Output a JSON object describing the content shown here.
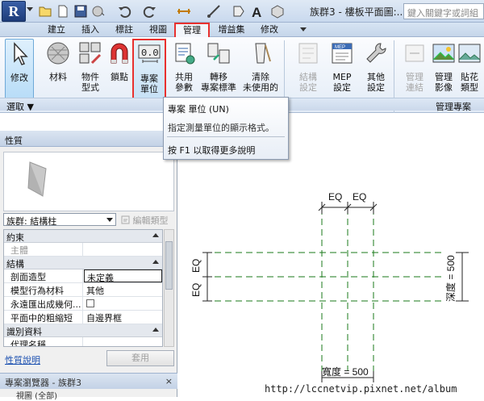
{
  "app": {
    "logo": "R",
    "title": "族群3 - 樓板平面圖:..",
    "search_placeholder": "鍵入關鍵字或詞組"
  },
  "tabs": [
    "建立",
    "插入",
    "標註",
    "視圖",
    "管理",
    "增益集",
    "修改"
  ],
  "active_tab": "管理",
  "ribbon": {
    "buttons": [
      {
        "id": "modify",
        "label": "修改",
        "icon": "cursor-icon"
      },
      {
        "id": "materials",
        "label": "材料",
        "icon": "sphere-icon"
      },
      {
        "id": "object-styles",
        "label": "物件\n型式",
        "icon": "object-styles-icon"
      },
      {
        "id": "snaps",
        "label": "鎖點",
        "icon": "magnet-icon"
      },
      {
        "id": "project-units",
        "label": "專案\n單位",
        "icon": "units-icon"
      },
      {
        "id": "shared-params",
        "label": "共用\n參數",
        "icon": "shared-params-icon"
      },
      {
        "id": "transfer-standards",
        "label": "轉移\n專案標準",
        "icon": "transfer-icon"
      },
      {
        "id": "purge-unused",
        "label": "清除\n未使用的",
        "icon": "purge-icon"
      },
      {
        "id": "structural-settings",
        "label": "結構\n設定",
        "icon": "structural-icon",
        "disabled": true
      },
      {
        "id": "mep-settings",
        "label": "MEP\n設定",
        "icon": "mep-icon"
      },
      {
        "id": "other-settings",
        "label": "其他\n設定",
        "icon": "wrench-icon"
      },
      {
        "id": "manage-links",
        "label": "管理\n連結",
        "icon": "links-icon",
        "disabled": true
      },
      {
        "id": "manage-images",
        "label": "管理\n影像",
        "icon": "images-icon"
      },
      {
        "id": "decal-types",
        "label": "貼花\n類型",
        "icon": "decal-icon"
      }
    ],
    "panel_select": "選取 ▼",
    "panel_manage_project": "管理專案"
  },
  "tooltip": {
    "title": "專案 單位 (UN)",
    "description": "指定測量單位的顯示格式。",
    "help": "按 F1 以取得更多說明"
  },
  "properties": {
    "header": "性質",
    "close": "×",
    "type_selector": "族群: 結構柱",
    "edit_type": "編輯類型",
    "groups": [
      {
        "name": "約束",
        "rows": [
          {
            "key": "主體",
            "value": "",
            "dim": true
          }
        ]
      },
      {
        "name": "結構",
        "rows": [
          {
            "key": "剖面造型",
            "value": "未定義",
            "boxed": true
          },
          {
            "key": "模型行為材料",
            "value": "其他"
          },
          {
            "key": "永遠匯出成幾何...",
            "value": "",
            "checkbox": true
          },
          {
            "key": "平面中的粗縮短",
            "value": "自邊界框"
          }
        ]
      },
      {
        "name": "識別資料",
        "rows": [
          {
            "key": "代理名稱",
            "value": ""
          }
        ]
      }
    ],
    "help_link": "性質說明",
    "apply": "套用"
  },
  "project_browser": {
    "header": "專案瀏覽器 - 族群3",
    "close": "×",
    "item": "視圖 (全部)"
  },
  "drawing": {
    "dim_top_left": "EQ",
    "dim_top_right": "EQ",
    "dim_left_top": "EQ",
    "dim_left_bottom": "EQ",
    "depth_label": "深度 = 500",
    "width_label": "寬度 = 500",
    "ref_line_color": "#1a7a1a"
  },
  "watermark": "http://lccnetvip.pixnet.net/album"
}
